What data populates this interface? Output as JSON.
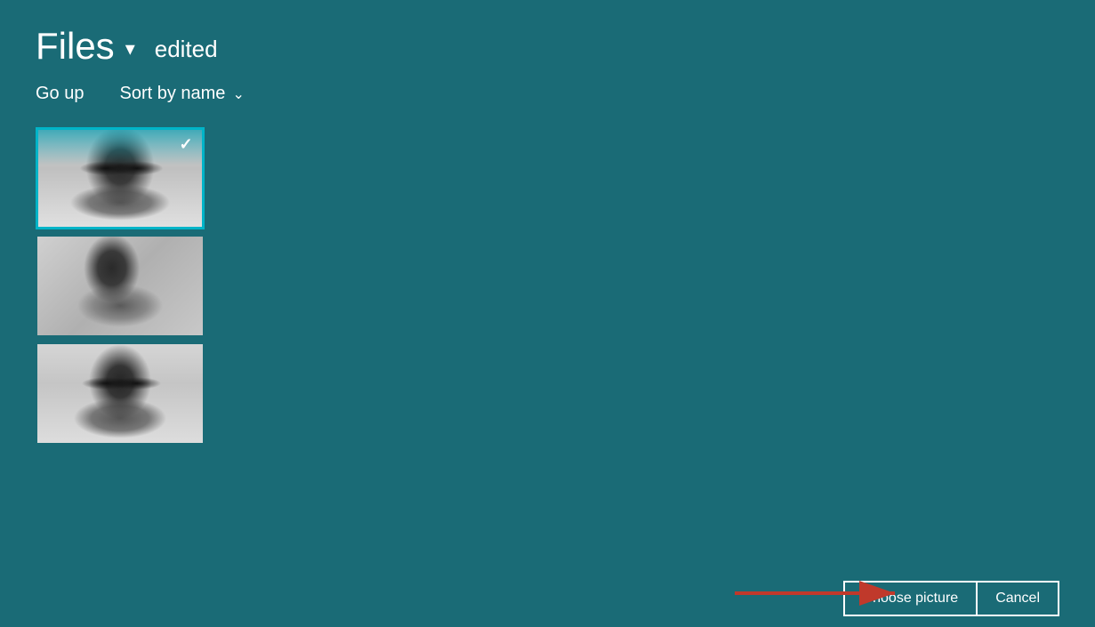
{
  "header": {
    "title": "Files",
    "dropdown_icon": "▾",
    "edited_label": "edited"
  },
  "toolbar": {
    "go_up_label": "Go up",
    "sort_label": "Sort by name",
    "sort_chevron": "⌄"
  },
  "files": [
    {
      "id": 1,
      "selected": true,
      "alt": "Photo 1 - portrait with sunglasses"
    },
    {
      "id": 2,
      "selected": false,
      "alt": "Photo 2 - outdoor portrait leaning"
    },
    {
      "id": 3,
      "selected": false,
      "alt": "Photo 3 - portrait with sunglasses similar"
    }
  ],
  "bottom_bar": {
    "choose_label": "Choose picture",
    "cancel_label": "Cancel"
  },
  "colors": {
    "background": "#1a6b76",
    "selected_border": "#00b4c8"
  }
}
